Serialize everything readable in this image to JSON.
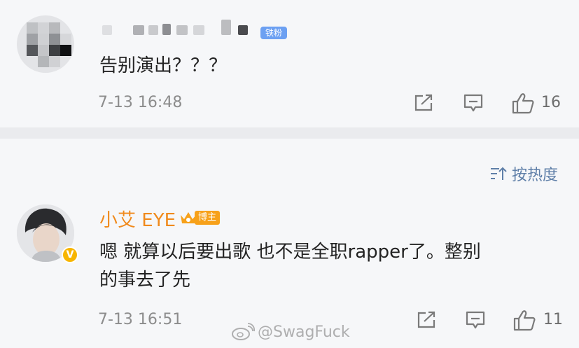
{
  "comments": [
    {
      "username_masked": true,
      "badge": "铁粉",
      "text": "告别演出？？？",
      "time": "7-13 16:48",
      "likes": "16"
    },
    {
      "username": "小艾 EYE",
      "badge": "博主",
      "verified_mark": "V",
      "text": "嗯 就算以后要出歌 也不是全职rapper了。整别\n的事去了先",
      "time": "7-13 16:51",
      "likes": "11"
    }
  ],
  "sort": {
    "label": "按热度"
  },
  "watermark": "@SwagFuck",
  "colors": {
    "background": "#f6f7f9",
    "divider": "#eaebee",
    "username_orange": "#f08a1c",
    "sort_blue": "#5f7fa8"
  }
}
